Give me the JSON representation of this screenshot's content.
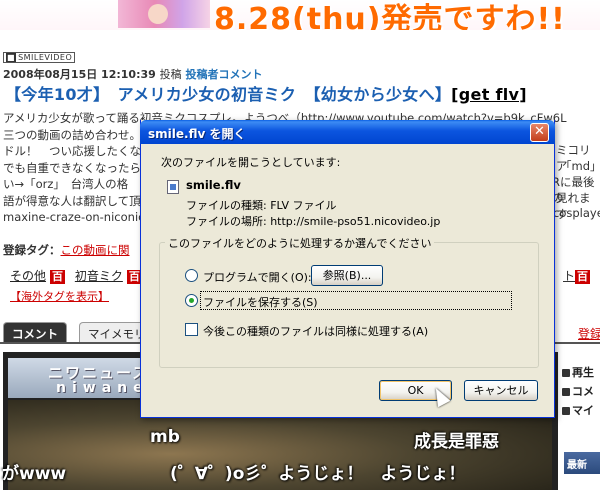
{
  "banner": {
    "text": "8.28(thu)発売ですわ!!"
  },
  "article": {
    "logo": "SMILEVIDEO",
    "logo_mark": "■",
    "datetime": "2008年08月15日 12:10:39",
    "post_label": "投稿",
    "uploader_comment": "投稿者コメント",
    "title": "【今年10才】　アメリカ少女の初音ミク　【幼女から少女へ】",
    "title_flv": "[get flv]",
    "description_lines": [
      "アメリカ少女が歌って踊る初音ミクコスプレ。ようつべ（http://www.youtube.com/watch?v=b9k_cFw6L",
      "三つの動画の詰め合わせ。",
      "ドル！　つい応援したくな",
      "でも自重できなくなったら",
      "い→「orz」　台湾人の格",
      "語が得意な人は翻訳して頂",
      "maxine-craze-on-niconic"
    ],
    "desc_right_fragments": [
      "ミコリア",
      "「md」",
      "Rに最後の",
      "見れます",
      "cosplaye"
    ],
    "tag_label": "登録タグ：",
    "tag_link": "この動画に関",
    "tags": [
      "その他",
      "初音ミク"
    ],
    "tag_badge": "百",
    "overseas_link": "【海外タグを表示】",
    "right_tag_fragment": "ト",
    "tab_comment": "コメント",
    "tab_mymemory": "マイメモリー",
    "right_link": "登録して"
  },
  "player": {
    "header_line1": "ニワニュース",
    "header_line2": "niwane",
    "comments": [
      "mb",
      "成長是罪惡",
      "がwww",
      "(゜∀゜)o彡゜ようじょ！　ようじょ！"
    ],
    "side_items": [
      "再生",
      "コメ",
      "マイ"
    ],
    "side_newest": "最新"
  },
  "dialog": {
    "title": "smile.flv を開く",
    "close_glyph": "✕",
    "intro": "次のファイルを開こうとしています:",
    "file_name": "smile.flv",
    "file_type": "ファイルの種類:  FLV ファイル",
    "file_from": "ファイルの場所:  http://smile-pso51.nicovideo.jp",
    "group_legend": "このファイルをどのように処理するか選んでください",
    "option_open": "プログラムで開く(O):",
    "browse_button": "参照(B)...",
    "option_save": "ファイルを保存する(S)",
    "option_always": "今後この種類のファイルは同様に処理する(A)",
    "ok_button": "OK",
    "cancel_button": "キャンセル",
    "selected_option": "save"
  }
}
